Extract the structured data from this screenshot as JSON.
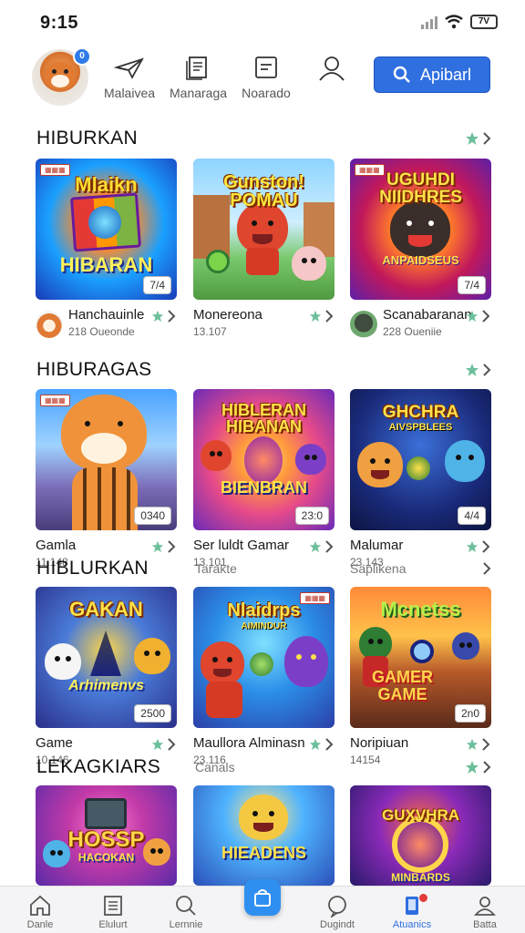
{
  "status_bar": {
    "time": "9:15",
    "battery": "7V"
  },
  "top_nav": {
    "items": [
      {
        "label": "Malaivea",
        "icon": "paper-plane-icon"
      },
      {
        "label": "Manaraga",
        "icon": "document-icon"
      },
      {
        "label": "Noarado",
        "icon": "list-icon"
      }
    ],
    "profile_icon": "person-icon",
    "badge": "0",
    "search_label": "Apibarl"
  },
  "sections": [
    {
      "title": "HIBURKAN",
      "cards": [
        {
          "name": "Hanchauinle",
          "meta": "218 Oueonde",
          "art_title": "Mlaikn",
          "art_sub": "HIBARAN",
          "badge": "7/4"
        },
        {
          "name": "Monereona",
          "meta": "13.107",
          "art_title": "Gunston! POMAU",
          "art_sub": "",
          "badge": ""
        },
        {
          "name": "Scanabaranan",
          "meta": "228 Oueniie",
          "art_title": "UGUHDI NIIDHRES",
          "art_sub": "ANPAIDSEUS",
          "badge": "7/4"
        }
      ]
    },
    {
      "title": "HIBURAGAS",
      "cards": [
        {
          "name": "Gamla",
          "meta": "11.148",
          "art_title": "",
          "art_sub": "",
          "badge": "0340"
        },
        {
          "name": "Ser luldt Gamar",
          "meta": "13.101",
          "art_title": "HIBLERAN HIBANAN",
          "art_sub": "BIENBRAN",
          "badge": "23:0"
        },
        {
          "name": "Malumar",
          "meta": "23.143",
          "art_title": "GHCHRA",
          "art_sub": "AIVSPBLEES",
          "badge": "4/4"
        }
      ]
    },
    {
      "title": "HIBLURKAN",
      "mid1": "Tarakte",
      "mid2": "Saplikena",
      "cards": [
        {
          "name": "Game",
          "meta": "10.146",
          "art_title": "GAKAN",
          "art_sub": "Arhimenvs",
          "badge": "2500"
        },
        {
          "name": "Maullora Alminasn",
          "meta": "23.116",
          "art_title": "Nlaidrps",
          "art_sub": "AIMINDUR",
          "badge": ""
        },
        {
          "name": "Noripiuan",
          "meta": "14154",
          "art_title": "Mcnetss",
          "art_sub": "GAMER GAME",
          "badge": "2n0"
        }
      ]
    },
    {
      "title": "LEKAGKIARS",
      "mid1": "Canals",
      "cards": [
        {
          "name": "",
          "meta": "",
          "art_title": "HOSSP",
          "art_sub": "HACOKAN"
        },
        {
          "name": "",
          "meta": "",
          "art_title": "",
          "art_sub": "HIEADENS"
        },
        {
          "name": "",
          "meta": "",
          "art_title": "GUXVHRA",
          "art_sub": "MINBARDS"
        }
      ]
    }
  ],
  "tab_bar": {
    "tabs": [
      {
        "label": "Danle",
        "icon": "home-icon"
      },
      {
        "label": "Elulurt",
        "icon": "list-icon"
      },
      {
        "label": "Lernnie",
        "icon": "search-icon"
      },
      {
        "label": "",
        "icon": "bag-icon"
      },
      {
        "label": "Dugindt",
        "icon": "chat-icon"
      },
      {
        "label": "Atuanics",
        "icon": "phone-icon"
      },
      {
        "label": "Batta",
        "icon": "person-icon"
      }
    ]
  },
  "colors": {
    "accent": "#2f6fe0",
    "star": "#6cbf9a"
  }
}
